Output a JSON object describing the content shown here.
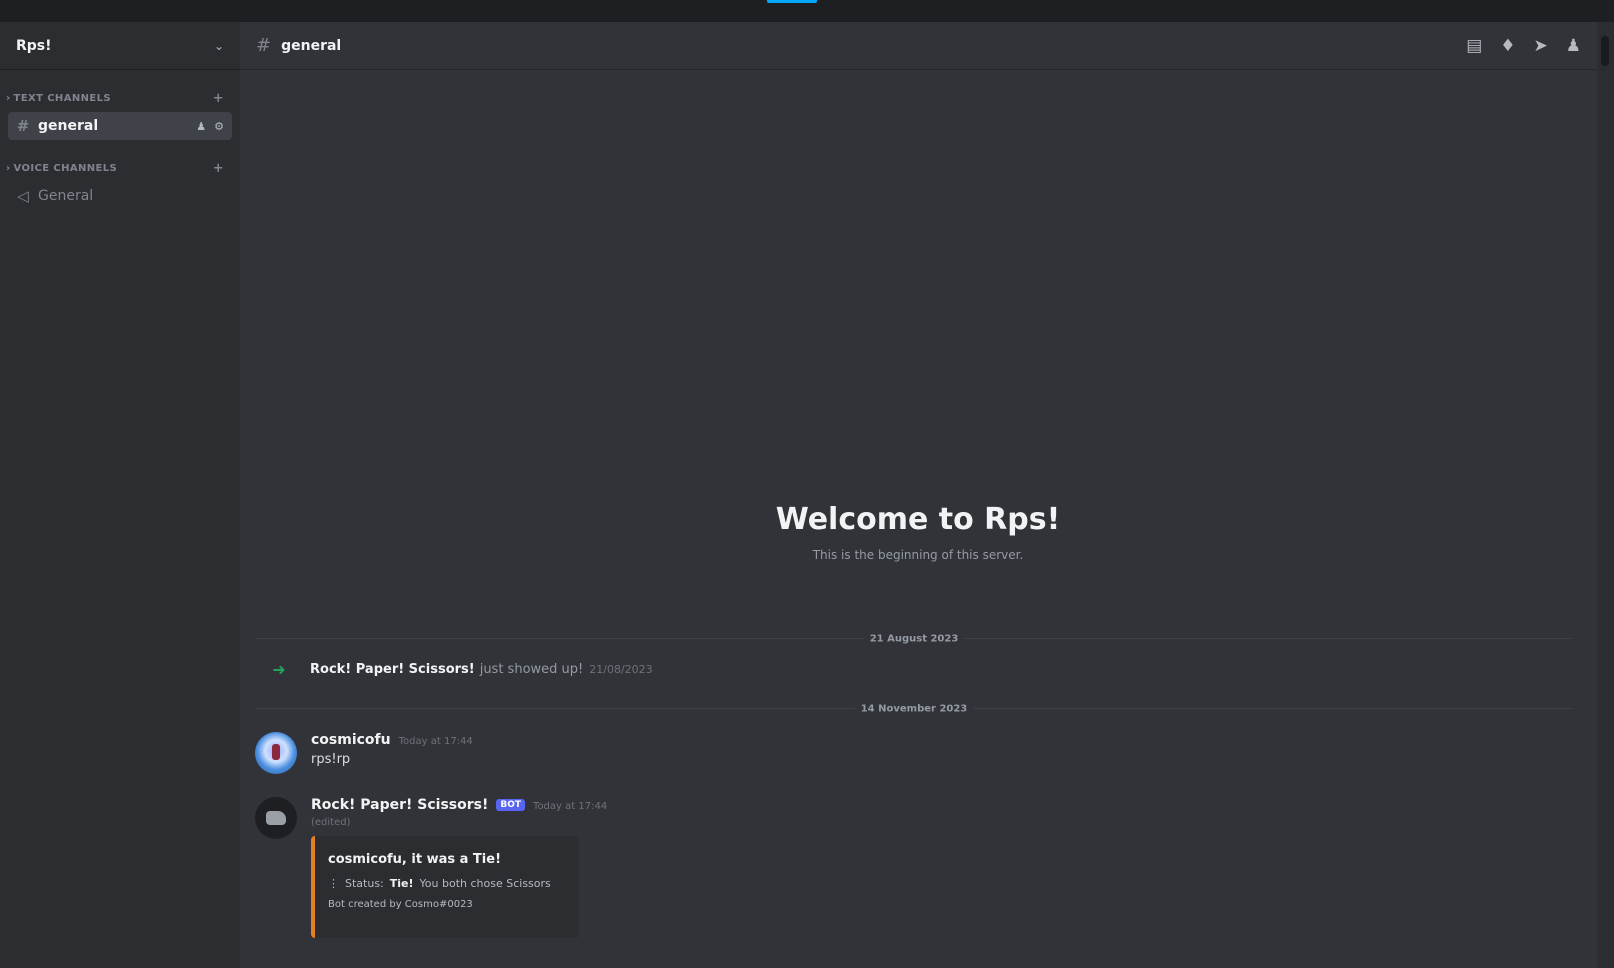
{
  "server": {
    "name": "Rps!"
  },
  "sidebar": {
    "text_category": "TEXT CHANNELS",
    "voice_category": "VOICE CHANNELS",
    "text_channels": [
      {
        "name": "general"
      }
    ],
    "voice_channels": [
      {
        "name": "General"
      }
    ]
  },
  "header": {
    "channel": "general"
  },
  "welcome": {
    "title": "Welcome to Rps!",
    "subtitle": "This is the beginning of this server."
  },
  "dividers": [
    "21 August 2023",
    "14 November 2023"
  ],
  "messages": {
    "join": {
      "user": "Rock! Paper! Scissors!",
      "text": "just showed up!",
      "time": "21/08/2023"
    },
    "user_msg": {
      "user": "cosmicofu",
      "time": "Today at 17:44",
      "text": "rps!rp"
    },
    "bot_msg": {
      "user": "Rock! Paper! Scissors!",
      "badge": "BOT",
      "time": "Today at 17:44",
      "edited": "(edited)",
      "embed": {
        "title": "cosmicofu, it was a Tie!",
        "accent_color": "#e67e22",
        "field_label": "Status:",
        "field_value": "Tie!",
        "field_detail": "You both chose Scissors",
        "footer": "Bot created by Cosmo#0023"
      }
    }
  },
  "colors": {
    "accent": "#00a8fc",
    "bot_badge": "#5865f2",
    "join_arrow": "#23a559"
  }
}
